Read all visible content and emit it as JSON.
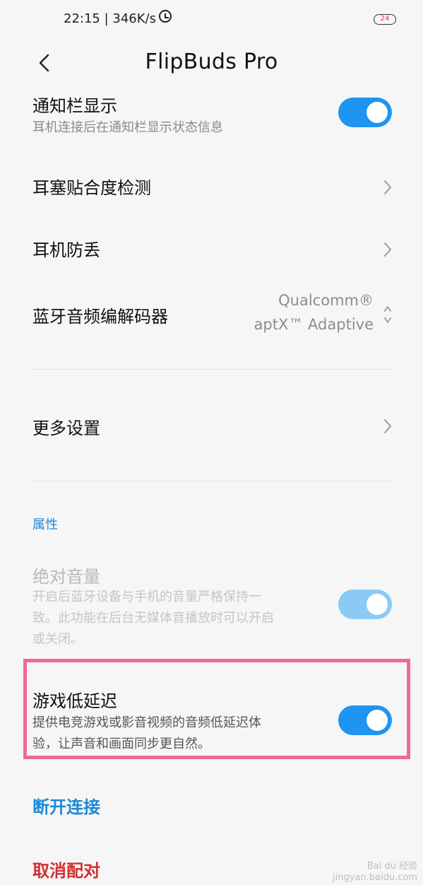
{
  "status_bar": {
    "time_speed": "22:15 | 346K/s",
    "battery": "24"
  },
  "header": {
    "title": "FlipBuds Pro"
  },
  "settings": {
    "notification": {
      "title": "通知栏显示",
      "subtitle": "耳机连接后在通知栏显示状态信息",
      "enabled": true
    },
    "fit_test": {
      "title": "耳塞贴合度检测"
    },
    "anti_lost": {
      "title": "耳机防丢"
    },
    "codec": {
      "title": "蓝牙音频编解码器",
      "value_line1": "Qualcomm®",
      "value_line2": "aptX™ Adaptive"
    },
    "more": {
      "title": "更多设置"
    }
  },
  "properties": {
    "section_label": "属性",
    "absolute_volume": {
      "title": "绝对音量",
      "subtitle_line1": "开启后蓝牙设备与手机的音量严格保持一",
      "subtitle_line2": "致。此功能在后台无媒体音播放时可以开启",
      "subtitle_line3": "或关闭。",
      "enabled": true,
      "disabled": true
    },
    "low_latency": {
      "title": "游戏低延迟",
      "subtitle_line1": "提供电竞游戏或影音视频的音频低延迟体",
      "subtitle_line2": "验，让声音和画面同步更自然。",
      "enabled": true
    }
  },
  "actions": {
    "disconnect": "断开连接",
    "unpair": "取消配对"
  },
  "colors": {
    "accent": "#1e95f0",
    "danger": "#d32f2f",
    "highlight_border": "#ef6a93"
  },
  "watermark": {
    "line1": "Bai du 经验",
    "line2": "jingyan.baidu.com"
  }
}
